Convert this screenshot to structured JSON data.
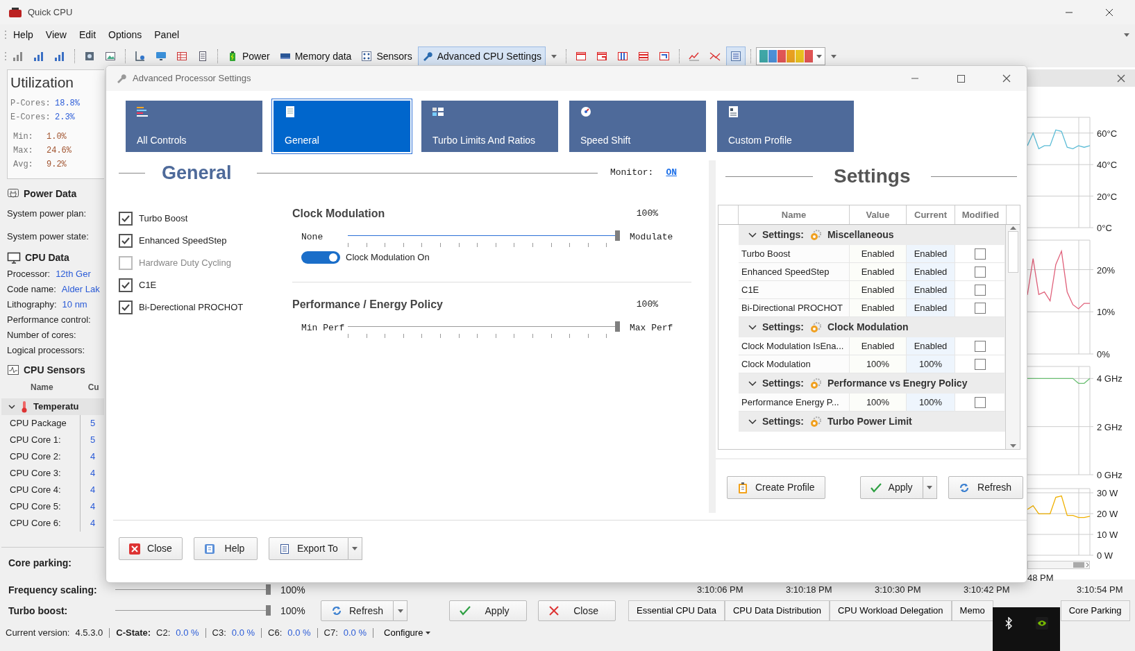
{
  "window": {
    "title": "Quick CPU"
  },
  "menu": [
    "Help",
    "View",
    "Edit",
    "Options",
    "Panel"
  ],
  "toolbar": [
    {
      "kind": "icon",
      "selected": false
    },
    {
      "kind": "icon",
      "selected": false
    },
    {
      "kind": "icon",
      "selected": false
    },
    {
      "kind": "separator"
    },
    {
      "kind": "icon",
      "selected": false
    },
    {
      "kind": "icon",
      "selected": false
    },
    {
      "kind": "separator"
    },
    {
      "kind": "icon",
      "selected": false
    },
    {
      "kind": "icon",
      "selected": false
    },
    {
      "kind": "icon",
      "selected": false
    },
    {
      "kind": "icon",
      "selected": false
    },
    {
      "kind": "separator"
    },
    {
      "kind": "labeled",
      "label": "Power",
      "selected": false
    },
    {
      "kind": "labeled",
      "label": "Memory data",
      "selected": false
    },
    {
      "kind": "labeled",
      "label": "Sensors",
      "selected": false
    },
    {
      "kind": "split",
      "label": "Advanced CPU Settings",
      "selected": true
    },
    {
      "kind": "separator"
    },
    {
      "kind": "icon",
      "selected": false
    },
    {
      "kind": "icon",
      "selected": false
    },
    {
      "kind": "icon",
      "selected": false
    },
    {
      "kind": "icon",
      "selected": false
    },
    {
      "kind": "icon",
      "selected": false
    },
    {
      "kind": "separator"
    },
    {
      "kind": "icon",
      "selected": false
    },
    {
      "kind": "icon",
      "selected": false
    },
    {
      "kind": "icon",
      "selected": true
    },
    {
      "kind": "separator"
    },
    {
      "kind": "palette"
    },
    {
      "kind": "overflow"
    }
  ],
  "utilization": {
    "title": "Utilization",
    "cores": [
      {
        "label": "P-Cores:",
        "value": "18.8%"
      },
      {
        "label": "E-Cores:",
        "value": "2.3%"
      }
    ],
    "stats": [
      {
        "label": "Min:",
        "value": "1.0%"
      },
      {
        "label": "Max:",
        "value": "24.6%"
      },
      {
        "label": "Avg:",
        "value": "9.2%"
      }
    ]
  },
  "power_data": {
    "title": "Power Data",
    "fields": [
      "System power plan:",
      "System power state:"
    ]
  },
  "cpu_data": {
    "title": "CPU Data",
    "fields": [
      {
        "label": "Processor:",
        "value": "12th Ger"
      },
      {
        "label": "Code name:",
        "value": "Alder Lak"
      },
      {
        "label": "Lithography:",
        "value": "10 nm"
      },
      {
        "label": "Performance control:"
      },
      {
        "label": "Number of cores:"
      },
      {
        "label": "Logical processors:"
      }
    ]
  },
  "cpu_sensors": {
    "title": "CPU Sensors",
    "columns": [
      "Name",
      "Cu"
    ],
    "groups": [
      {
        "title": "Temperatu",
        "expanded": true,
        "rows": [
          {
            "name": "CPU Package",
            "value": "5"
          },
          {
            "name": "CPU Core 1:",
            "value": "5"
          },
          {
            "name": "CPU Core 2:",
            "value": "4"
          },
          {
            "name": "CPU Core 3:",
            "value": "4"
          },
          {
            "name": "CPU Core 4:",
            "value": "4"
          },
          {
            "name": "CPU Core 5:",
            "value": "4"
          },
          {
            "name": "CPU Core 6:",
            "value": "4"
          }
        ]
      }
    ]
  },
  "core_parking": {
    "label": "Core parking:"
  },
  "scaling": [
    {
      "label": "Frequency scaling:",
      "level": 1,
      "reading": "100%"
    },
    {
      "label": "Turbo boost:",
      "level": 1,
      "reading": "100%"
    }
  ],
  "main_buttons": [
    {
      "label": "Refresh",
      "dropdown": true
    },
    {
      "label": "Apply",
      "dropdown": false
    },
    {
      "label": "Close",
      "dropdown": false
    }
  ],
  "time_axis": [
    "3:10:06 PM",
    "3:10:18 PM",
    "3:10:30 PM",
    "3:10:42 PM",
    "3:10:54 PM"
  ],
  "bottom_tabs": [
    {
      "label": "Essential CPU Data",
      "selected": false
    },
    {
      "label": "CPU Data Distribution",
      "selected": false
    },
    {
      "label": "CPU Workload Delegation",
      "selected": false
    },
    {
      "label": "Memo",
      "selected": false
    },
    {
      "label": "Core Parking",
      "selected": false
    }
  ],
  "side_charts": {
    "time_label": "48 PM",
    "charts": [
      {
        "chart_data": {
          "type": "line",
          "grid": true,
          "ylim": [
            0,
            70
          ],
          "yticks": [
            {
              "value": 60,
              "label": "60°C"
            },
            {
              "value": 40,
              "label": "40°C"
            },
            {
              "value": 20,
              "label": "20°C"
            },
            {
              "value": 0,
              "label": "0°C"
            }
          ],
          "series": [
            {
              "color": "#5bbcd6",
              "values": [
                52,
                60,
                50,
                52,
                52,
                62,
                61,
                51,
                50,
                52,
                51,
                52
              ]
            }
          ]
        }
      },
      {
        "chart_data": {
          "type": "line",
          "grid": true,
          "ylim": [
            0,
            27
          ],
          "yticks": [
            {
              "value": 20,
              "label": "20%"
            },
            {
              "value": 10,
              "label": "10%"
            },
            {
              "value": 0,
              "label": "0%"
            }
          ],
          "series": [
            {
              "color": "#e0607a",
              "values": [
                14,
                22.6,
                14.1,
                14.7,
                12.6,
                21.2,
                24.4,
                14.7,
                11.7,
                10.7,
                12,
                12
              ]
            }
          ]
        }
      },
      {
        "chart_data": {
          "type": "line",
          "grid": true,
          "ylim": [
            0,
            4.5
          ],
          "yticks": [
            {
              "value": 4,
              "label": "4 GHz"
            },
            {
              "value": 2,
              "label": "2 GHz"
            },
            {
              "value": 0,
              "label": "0 GHz"
            }
          ],
          "series": [
            {
              "color": "#6bbf73",
              "values": [
                4,
                4,
                4,
                4,
                4,
                4,
                4,
                4,
                4,
                3.8,
                3.8,
                4
              ]
            }
          ]
        }
      },
      {
        "chart_data": {
          "type": "line",
          "grid": true,
          "ylim": [
            0,
            32
          ],
          "yticks": [
            {
              "value": 30,
              "label": "30 W"
            },
            {
              "value": 20,
              "label": "20 W"
            },
            {
              "value": 10,
              "label": "10 W"
            },
            {
              "value": 0,
              "label": "0 W"
            }
          ],
          "series": [
            {
              "color": "#f0b000",
              "values": [
                22,
                23.8,
                19.9,
                19.9,
                19.9,
                27.8,
                28.5,
                19.1,
                19.1,
                18.1,
                18.1,
                18.7
              ]
            }
          ]
        }
      }
    ]
  },
  "status_bar": {
    "version_label": "Current version:",
    "version": "4.5.3.0",
    "cstate_label": "C-State:",
    "cstates": [
      {
        "label": "C2:",
        "value": "0.0 %"
      },
      {
        "label": "C3:",
        "value": "0.0 %"
      },
      {
        "label": "C6:",
        "value": "0.0 %"
      },
      {
        "label": "C7:",
        "value": "0.0 %"
      }
    ],
    "configure": "Configure"
  },
  "dialog": {
    "title": "Advanced Processor Settings",
    "tabs": [
      {
        "label": "All Controls",
        "selected": false
      },
      {
        "label": "General",
        "selected": true
      },
      {
        "label": "Turbo Limits And Ratios",
        "selected": false
      },
      {
        "label": "Speed Shift",
        "selected": false
      },
      {
        "label": "Custom Profile",
        "selected": false
      }
    ],
    "section_title": "General",
    "monitor": {
      "label": "Monitor:",
      "value": "ON"
    },
    "options": [
      {
        "label": "Turbo Boost",
        "checked": true,
        "disabled": false
      },
      {
        "label": "Enhanced SpeedStep",
        "checked": true,
        "disabled": false
      },
      {
        "label": "Hardware Duty Cycling",
        "checked": false,
        "disabled": true
      },
      {
        "label": "C1E",
        "checked": true,
        "disabled": false
      },
      {
        "label": "Bi-Derectional PROCHOT",
        "checked": true,
        "disabled": false
      }
    ],
    "sliders": [
      {
        "title": "Clock Modulation",
        "reading": "100%",
        "min_label": "None",
        "max_label": "Modulate",
        "level": 1,
        "focused": true,
        "toggle": {
          "label": "Clock Modulation On",
          "on": true
        }
      },
      {
        "title": "Performance / Energy Policy",
        "reading": "100%",
        "min_label": "Min Perf",
        "max_label": "Max Perf",
        "level": 1,
        "focused": false
      }
    ],
    "settings": {
      "title": "Settings",
      "columns": [
        "Name",
        "Value",
        "Current",
        "Modified"
      ],
      "groups": [
        {
          "prefix": "Settings:",
          "title": "Miscellaneous",
          "expanded": true,
          "rows": [
            {
              "name": "Turbo Boost",
              "value": "Enabled",
              "current": "Enabled",
              "modified": false
            },
            {
              "name": "Enhanced SpeedStep",
              "value": "Enabled",
              "current": "Enabled",
              "modified": false
            },
            {
              "name": "C1E",
              "value": "Enabled",
              "current": "Enabled",
              "modified": false
            },
            {
              "name": "Bi-Directional PROCHOT",
              "value": "Enabled",
              "current": "Enabled",
              "modified": false
            }
          ]
        },
        {
          "prefix": "Settings:",
          "title": "Clock Modulation",
          "expanded": true,
          "rows": [
            {
              "name": "Clock Modulation IsEna...",
              "value": "Enabled",
              "current": "Enabled",
              "modified": false
            },
            {
              "name": "Clock Modulation",
              "value": "100%",
              "current": "100%",
              "modified": false
            }
          ]
        },
        {
          "prefix": "Settings:",
          "title": "Performance vs Enegry Policy",
          "expanded": true,
          "rows": [
            {
              "name": "Performance Energy P...",
              "value": "100%",
              "current": "100%",
              "modified": false
            }
          ]
        },
        {
          "prefix": "Settings:",
          "title": "Turbo Power Limit",
          "expanded": true
        }
      ]
    },
    "settings_buttons": [
      {
        "label": "Create Profile",
        "dropdown": false
      },
      {
        "label": "Apply",
        "dropdown": true
      },
      {
        "label": "Refresh",
        "dropdown": false
      }
    ],
    "buttons": [
      {
        "label": "Close",
        "dropdown": false
      },
      {
        "label": "Help",
        "dropdown": false
      },
      {
        "label": "Export To",
        "dropdown": true
      }
    ]
  }
}
